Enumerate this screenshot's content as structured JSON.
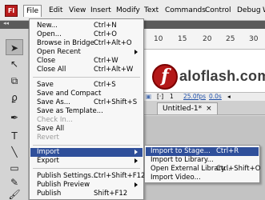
{
  "app": {
    "logo_text": "Fl"
  },
  "menubar": [
    "File",
    "Edit",
    "View",
    "Insert",
    "Modify",
    "Text",
    "Commands",
    "Control",
    "Debug",
    "W"
  ],
  "timeline": {
    "ruler_numbers": [
      "10",
      "15",
      "20",
      "25",
      "30"
    ],
    "frame": "1",
    "fps": "25.0fps",
    "elapsed": "0.0s"
  },
  "document_tab": {
    "title": "Untitled-1*",
    "close": "×"
  },
  "watermark": {
    "glyph": "f",
    "text": "aloflash.com"
  },
  "file_menu": [
    {
      "label": "New...",
      "shortcut": "Ctrl+N"
    },
    {
      "label": "Open...",
      "shortcut": "Ctrl+O"
    },
    {
      "label": "Browse in Bridge",
      "shortcut": "Ctrl+Alt+O"
    },
    {
      "label": "Open Recent",
      "shortcut": "",
      "submenu": true
    },
    {
      "label": "Close",
      "shortcut": "Ctrl+W"
    },
    {
      "label": "Close All",
      "shortcut": "Ctrl+Alt+W"
    },
    {
      "label": "Save",
      "shortcut": "Ctrl+S"
    },
    {
      "label": "Save and Compact",
      "shortcut": ""
    },
    {
      "label": "Save As...",
      "shortcut": "Ctrl+Shift+S"
    },
    {
      "label": "Save as Template...",
      "shortcut": ""
    },
    {
      "label": "Check In...",
      "shortcut": "",
      "disabled": true
    },
    {
      "label": "Save All",
      "shortcut": ""
    },
    {
      "label": "Revert",
      "shortcut": "",
      "disabled": true
    },
    {
      "label": "Import",
      "shortcut": "",
      "submenu": true,
      "highlighted": true
    },
    {
      "label": "Export",
      "shortcut": "",
      "submenu": true
    },
    {
      "label": "Publish Settings...",
      "shortcut": "Ctrl+Shift+F12"
    },
    {
      "label": "Publish Preview",
      "shortcut": "",
      "submenu": true
    },
    {
      "label": "Publish",
      "shortcut": "Shift+F12"
    }
  ],
  "import_submenu": [
    {
      "label": "Import to Stage...",
      "shortcut": "Ctrl+R",
      "highlighted": true
    },
    {
      "label": "Import to Library...",
      "shortcut": ""
    },
    {
      "label": "Open External Library...",
      "shortcut": "Ctrl+Shift+O"
    },
    {
      "label": "Import Video...",
      "shortcut": ""
    }
  ],
  "colors": {
    "highlight": "#2f4f9a",
    "logo": "#b91c1c",
    "disabled": "#9a9a9a"
  }
}
